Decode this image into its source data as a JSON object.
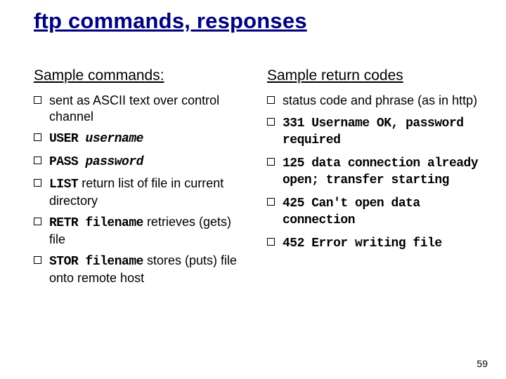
{
  "title": "ftp commands, responses",
  "left": {
    "heading": "Sample commands:",
    "items": [
      {
        "pre": "",
        "code": "",
        "post": "sent as ASCII text over control channel"
      },
      {
        "pre": "",
        "code": "USER ",
        "ital": "username",
        "post": ""
      },
      {
        "pre": "",
        "code": "PASS ",
        "ital": "password",
        "post": ""
      },
      {
        "pre": "",
        "code": "LIST",
        "post": " return list of file in current directory"
      },
      {
        "pre": "",
        "code": "RETR filename",
        "post": " retrieves (gets) file"
      },
      {
        "pre": "",
        "code": "STOR filename",
        "post": " stores (puts) file onto remote host"
      }
    ]
  },
  "right": {
    "heading": "Sample return codes",
    "items": [
      {
        "pre": "status code and phrase (as in http)",
        "code": "",
        "post": ""
      },
      {
        "pre": "",
        "code": "331 Username OK, password required",
        "post": ""
      },
      {
        "pre": "",
        "code": "125 data connection already open; transfer starting",
        "post": ""
      },
      {
        "pre": "",
        "code": "425 Can't open data connection",
        "post": ""
      },
      {
        "pre": "",
        "code": "452 Error writing file",
        "post": ""
      }
    ]
  },
  "page": "59"
}
